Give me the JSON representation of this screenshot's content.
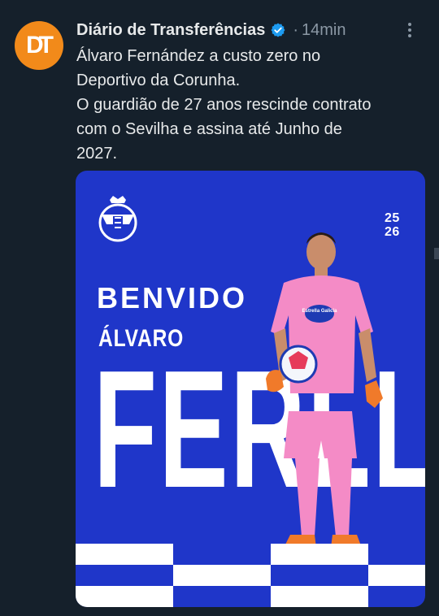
{
  "tweet": {
    "avatar_initials": "DT",
    "author_name": "Diário de Transferências",
    "separator": "·",
    "timestamp": "14min",
    "verified_icon": "verified-badge-icon",
    "more_icon": "more-dots-icon",
    "text_lines": [
      "Álvaro Fernández a custo zero no",
      "Deportivo da Corunha.",
      "O guardião de 27 anos rescinde contrato",
      "com o Sevilha e assina até Junho de",
      "2027."
    ]
  },
  "media": {
    "season_top": "25",
    "season_bottom": "26",
    "headline": "BENVIDO",
    "first_name": "ÁLVARO",
    "surname": "FERLLO",
    "sponsor": "Estrella Galicia",
    "colors": {
      "background": "#1f36c9",
      "checker": "#ffffff",
      "kit": "#f48bc6"
    }
  },
  "colors": {
    "page_bg": "#15202b",
    "avatar_bg": "#f28a1a",
    "verified": "#1d9bf0"
  }
}
